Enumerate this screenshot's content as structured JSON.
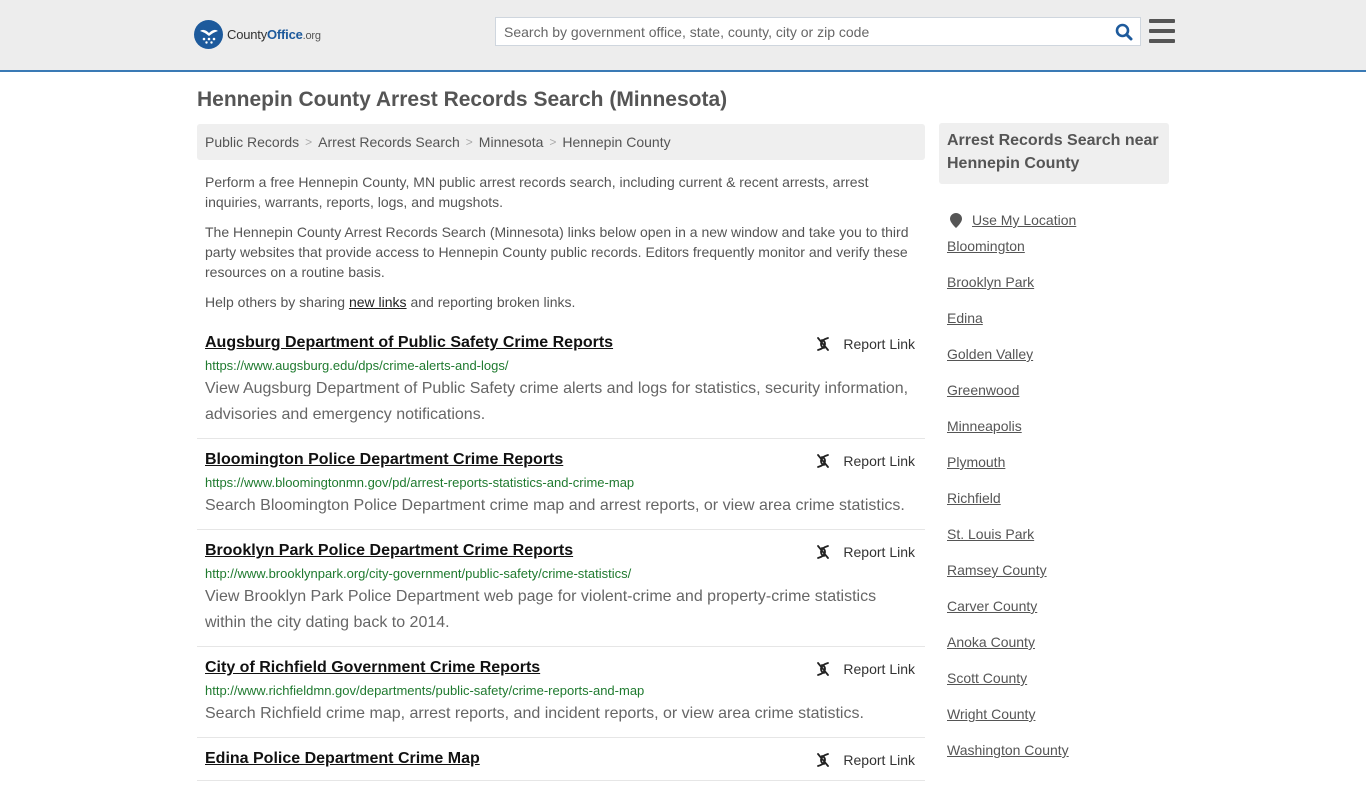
{
  "header": {
    "logo": {
      "name": "County",
      "name_bold": "Office",
      "tld": ".org"
    },
    "search": {
      "placeholder": "Search by government office, state, county, city or zip code",
      "value": ""
    }
  },
  "page": {
    "title": "Hennepin County Arrest Records Search (Minnesota)"
  },
  "breadcrumb": [
    {
      "label": "Public Records"
    },
    {
      "label": "Arrest Records Search"
    },
    {
      "label": "Minnesota"
    },
    {
      "label": "Hennepin County"
    }
  ],
  "intro": {
    "p1": "Perform a free Hennepin County, MN public arrest records search, including current & recent arrests, arrest inquiries, warrants, reports, logs, and mugshots.",
    "p2": "The Hennepin County Arrest Records Search (Minnesota) links below open in a new window and take you to third party websites that provide access to Hennepin County public records. Editors frequently monitor and verify these resources on a routine basis.",
    "p3_before": "Help others by sharing ",
    "p3_link": "new links",
    "p3_after": " and reporting broken links."
  },
  "report_label": "Report Link",
  "results": [
    {
      "title": "Augsburg Department of Public Safety Crime Reports",
      "url": "https://www.augsburg.edu/dps/crime-alerts-and-logs/",
      "desc": "View Augsburg Department of Public Safety crime alerts and logs for statistics, security information, advisories and emergency notifications."
    },
    {
      "title": "Bloomington Police Department Crime Reports",
      "url": "https://www.bloomingtonmn.gov/pd/arrest-reports-statistics-and-crime-map",
      "desc": "Search Bloomington Police Department crime map and arrest reports, or view area crime statistics."
    },
    {
      "title": "Brooklyn Park Police Department Crime Reports",
      "url": "http://www.brooklynpark.org/city-government/public-safety/crime-statistics/",
      "desc": "View Brooklyn Park Police Department web page for violent-crime and property-crime statistics within the city dating back to 2014."
    },
    {
      "title": "City of Richfield Government Crime Reports",
      "url": "http://www.richfieldmn.gov/departments/public-safety/crime-reports-and-map",
      "desc": "Search Richfield crime map, arrest reports, and incident reports, or view area crime statistics."
    },
    {
      "title": "Edina Police Department Crime Map",
      "url": "",
      "desc": ""
    }
  ],
  "sidebar": {
    "heading": "Arrest Records Search near Hennepin County",
    "use_location": "Use My Location",
    "links": [
      "Bloomington",
      "Brooklyn Park",
      "Edina",
      "Golden Valley",
      "Greenwood",
      "Minneapolis",
      "Plymouth",
      "Richfield",
      "St. Louis Park",
      "Ramsey County",
      "Carver County",
      "Anoka County",
      "Scott County",
      "Wright County",
      "Washington County"
    ]
  }
}
